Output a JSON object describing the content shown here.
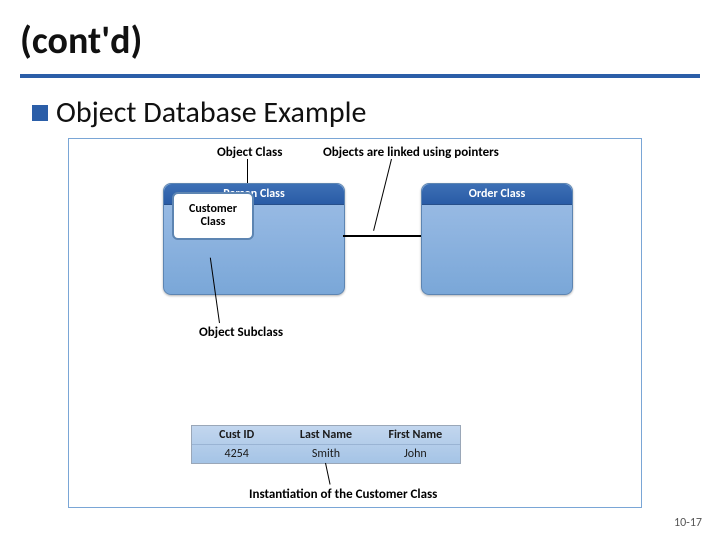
{
  "title": "(cont'd)",
  "bullet": "Object Database Example",
  "labels": {
    "object_class": "Object Class",
    "pointers": "Objects are linked using pointers",
    "subclass": "Object Subclass",
    "instantiation": "Instantiation of the Customer Class"
  },
  "panels": {
    "person": "Person Class",
    "order": "Order Class",
    "customer": "Customer\nClass"
  },
  "table": {
    "headers": [
      "Cust ID",
      "Last Name",
      "First Name"
    ],
    "row": [
      "4254",
      "Smith",
      "John"
    ]
  },
  "pagenum": "10-17"
}
